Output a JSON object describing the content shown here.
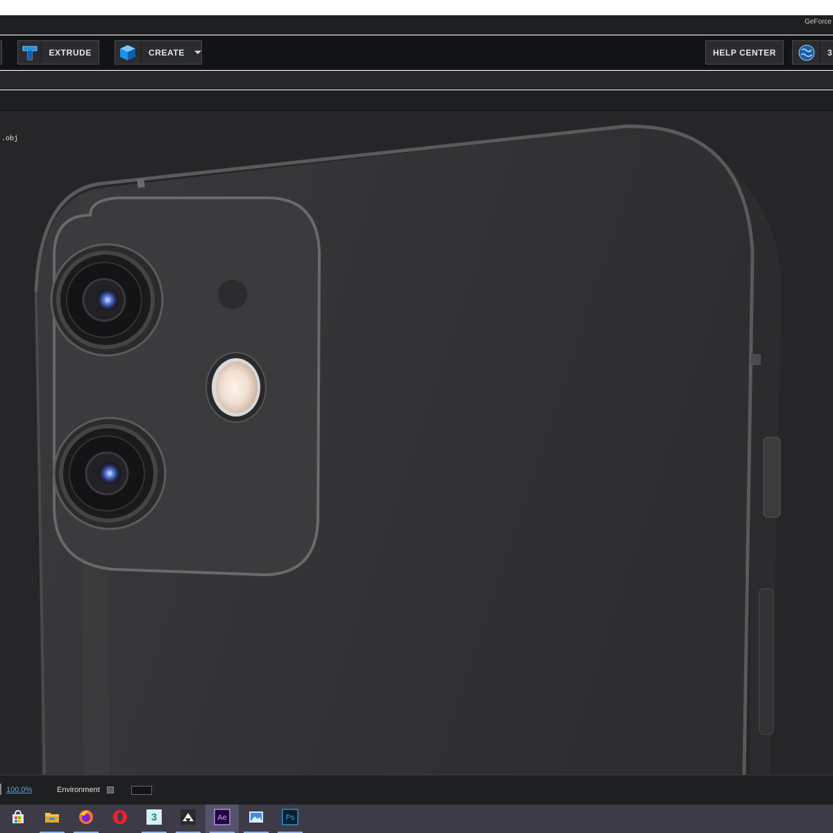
{
  "window": {
    "corner_text": "GeForce"
  },
  "toolbar": {
    "extrude_label": "EXTRUDE",
    "create_label": "CREATE",
    "help_center_label": "HELP CENTER",
    "extra_label": "3"
  },
  "viewport": {
    "file_label": ".obj"
  },
  "statusbar": {
    "zoom": "100.0%",
    "environment_label": "Environment"
  },
  "taskbar": {
    "apps": [
      "store-icon",
      "file-explorer-icon",
      "firefox-icon",
      "opera-icon",
      "3ds-max-icon",
      "inkscape-icon",
      "after-effects-icon",
      "photos-icon",
      "photoshop-icon"
    ],
    "active_app": "after-effects-icon"
  },
  "colors": {
    "toolbar_bg": "#121314",
    "button_bg": "#2a2c30",
    "viewport_bg": "#262628",
    "phone_body": "#363638",
    "zoom_link": "#5ea0e6",
    "taskbar_bg": "#3d3b48"
  }
}
